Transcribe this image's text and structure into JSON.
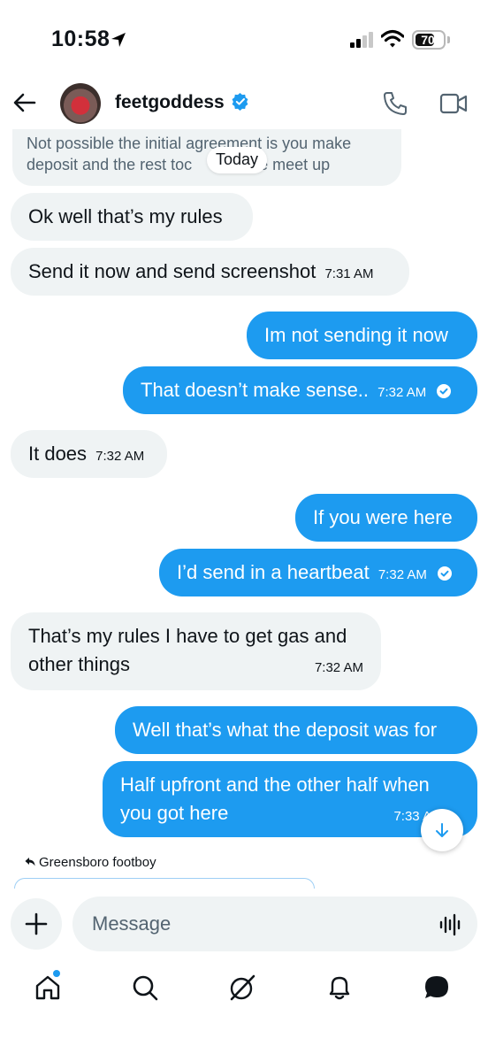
{
  "status_bar": {
    "time": "10:58",
    "battery": "70"
  },
  "header": {
    "username": "feetgoddess"
  },
  "chat": {
    "first_line1": "Not possible the initial agreement is you make",
    "first_line2": "deposit and the rest toc",
    "first_line2_end": "e meet up",
    "today_label": "Today",
    "messages": [
      {
        "text": "Ok well that’s my rules",
        "time": ""
      },
      {
        "text": "Send it now and send screenshot",
        "time": "7:31 AM"
      },
      {
        "text": "Im not sending it now",
        "time": ""
      },
      {
        "text": "That doesn’t make sense..",
        "time": "7:32 AM"
      },
      {
        "text": "It does",
        "time": "7:32 AM"
      },
      {
        "text": "If you were here",
        "time": ""
      },
      {
        "text": "I’d send in a heartbeat",
        "time": "7:32 AM"
      },
      {
        "text": "That’s my rules I have to get gas and",
        "text2": "other things",
        "time": "7:32 AM"
      },
      {
        "text": "Well that’s what the deposit was for",
        "time": ""
      },
      {
        "text": "Half upfront and the other half when",
        "text2": "you got here",
        "time": "7:33 A"
      }
    ],
    "reply_to": "Greensboro footboy"
  },
  "composer": {
    "placeholder": "Message"
  },
  "colors": {
    "accent": "#1d9bf0",
    "received_bg": "#eff3f4",
    "text": "#0f1419"
  },
  "icons": {
    "tabs": [
      "home-icon",
      "search-icon",
      "grok-icon",
      "notifications-icon",
      "messages-icon"
    ]
  }
}
